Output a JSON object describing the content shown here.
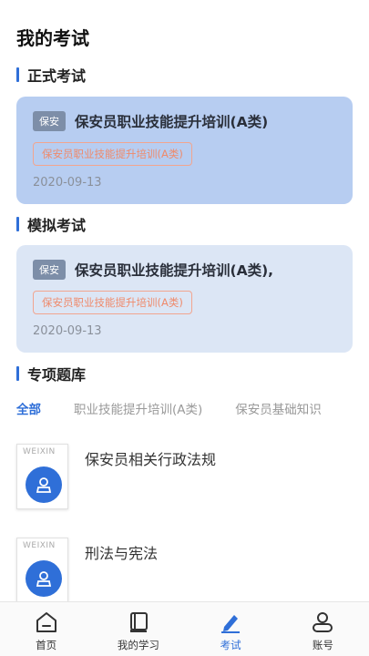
{
  "header": {
    "title": "我的考试"
  },
  "sections": {
    "formal": "正式考试",
    "mock": "模拟考试",
    "bank": "专项题库"
  },
  "formal_exam": {
    "tag": "保安",
    "title": "保安员职业技能提升培训(A类)",
    "chip": "保安员职业技能提升培训(A类)",
    "date": "2020-09-13"
  },
  "mock_exam": {
    "tag": "保安",
    "title": "保安员职业技能提升培训(A类),",
    "chip": "保安员职业技能提升培训(A类)",
    "date": "2020-09-13"
  },
  "category_tabs": [
    "全部",
    "职业技能提升培训(A类)",
    "保安员基础知识"
  ],
  "bank_items": [
    {
      "cover_text": "WEIXIN",
      "title": "保安员相关行政法规"
    },
    {
      "cover_text": "WEIXIN",
      "title": "刑法与宪法"
    }
  ],
  "nav": {
    "home": "首页",
    "study": "我的学习",
    "exam": "考试",
    "account": "账号"
  },
  "colors": {
    "accent": "#2f6fd8",
    "tag": "#7d8ea8",
    "chip": "#ef8a6b"
  }
}
